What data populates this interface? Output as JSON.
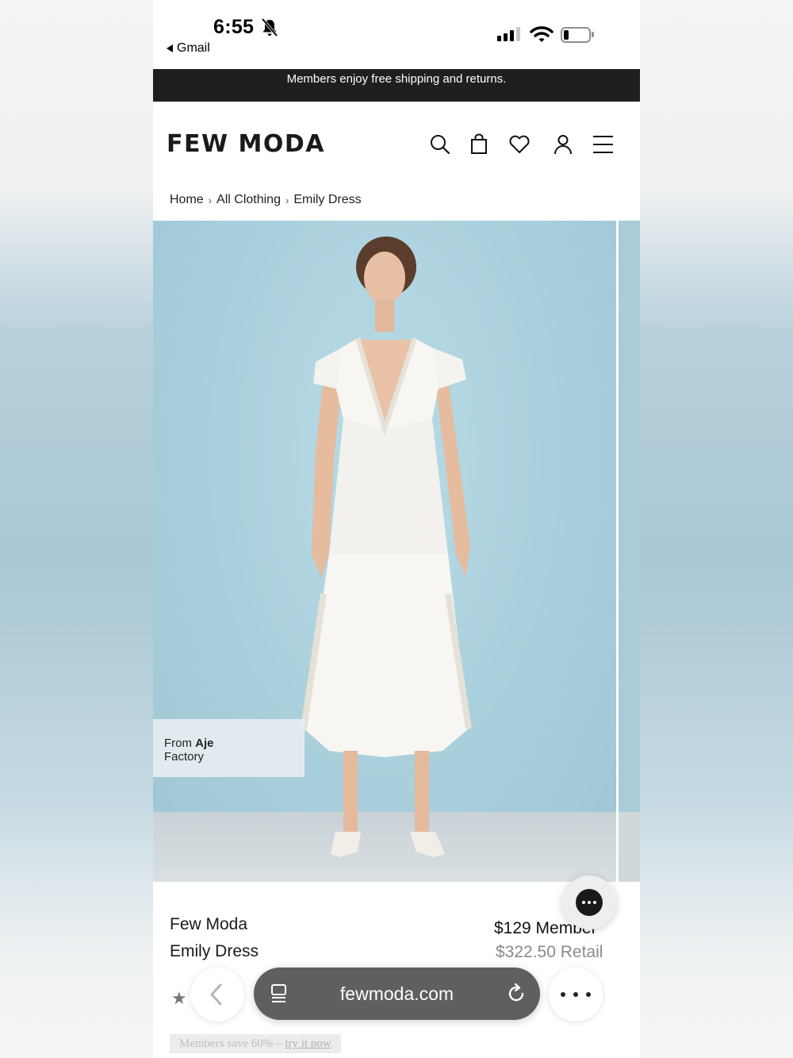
{
  "status_bar": {
    "time": "6:55",
    "back_app": "Gmail"
  },
  "promo_banner": {
    "text": "Members enjoy free shipping and returns."
  },
  "header": {
    "logo": "FEW MODA",
    "icons": [
      "search-icon",
      "shopping-bag-icon",
      "heart-icon",
      "account-icon",
      "menu-icon"
    ]
  },
  "breadcrumb": {
    "items": [
      "Home",
      "All Clothing",
      "Emily Dress"
    ]
  },
  "product": {
    "source_tag_prefix": "From ",
    "source_tag_name": "Aje",
    "source_tag_suffix": "Factory",
    "brand": "Few Moda",
    "name": "Emily Dress",
    "member_price": "$129 Member",
    "retail_price": "$322.50 Retail"
  },
  "members_strip": {
    "text": "Members save 60% – ",
    "link": "try it now"
  },
  "browser": {
    "url": "fewmoda.com"
  },
  "colors": {
    "banner_bg": "#1f1f1f",
    "photo_bg": "#a9cfdc",
    "url_bar": "#5f5f5f"
  }
}
